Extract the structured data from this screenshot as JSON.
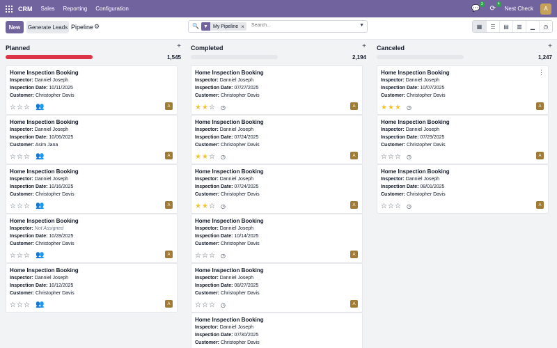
{
  "nav": {
    "app_name": "CRM",
    "menu": [
      "Sales",
      "Reporting",
      "Configuration"
    ],
    "chat_count": "3",
    "activity_count": "4",
    "company": "Nest Check",
    "user_initial": "A"
  },
  "control": {
    "new_label": "New",
    "generate_label": "Generate Leads",
    "breadcrumb": "Pipeline",
    "facet": "My Pipeline",
    "search_placeholder": "Search..."
  },
  "columns": [
    {
      "title": "Planned",
      "count": "1,545",
      "progress_fraction": 1.0,
      "cards": [
        {
          "title": "Home Inspection Booking",
          "inspector": "Danniel Joseph",
          "inspector_italic": false,
          "date": "10/11/2025",
          "customer": "Christopher Davis",
          "stars": 0,
          "icon": "people",
          "owner": "A"
        },
        {
          "title": "Home Inspection Booking",
          "inspector": "Danniel Joseph",
          "inspector_italic": false,
          "date": "10/06/2025",
          "customer": "Asim Jana",
          "stars": 0,
          "icon": "people",
          "owner": "A"
        },
        {
          "title": "Home Inspection Booking",
          "inspector": "Danniel Joseph",
          "inspector_italic": false,
          "date": "10/16/2025",
          "customer": "Christopher Davis",
          "stars": 0,
          "icon": "people",
          "owner": "A"
        },
        {
          "title": "Home Inspection Booking",
          "inspector": "Not Assigned",
          "inspector_italic": true,
          "date": "10/28/2025",
          "customer": "Christopher Davis",
          "stars": 0,
          "icon": "people",
          "owner": "A"
        },
        {
          "title": "Home Inspection Booking",
          "inspector": "Danniel Joseph",
          "inspector_italic": false,
          "date": "10/12/2025",
          "customer": "Christopher Davis",
          "stars": 0,
          "icon": "people",
          "owner": "A"
        }
      ]
    },
    {
      "title": "Completed",
      "count": "2,194",
      "progress_fraction": 0.0,
      "cards": [
        {
          "title": "Home Inspection Booking",
          "inspector": "Danniel Joseph",
          "inspector_italic": false,
          "date": "07/27/2025",
          "customer": "Christopher Davis",
          "stars": 2,
          "icon": "clock",
          "owner": "A"
        },
        {
          "title": "Home Inspection Booking",
          "inspector": "Danniel Joseph",
          "inspector_italic": false,
          "date": "07/24/2025",
          "customer": "Christopher Davis",
          "stars": 2,
          "icon": "clock",
          "owner": "A"
        },
        {
          "title": "Home Inspection Booking",
          "inspector": "Danniel Joseph",
          "inspector_italic": false,
          "date": "07/24/2025",
          "customer": "Christopher Davis",
          "stars": 2,
          "icon": "clock",
          "owner": "A"
        },
        {
          "title": "Home Inspection Booking",
          "inspector": "Danniel Joseph",
          "inspector_italic": false,
          "date": "10/14/2025",
          "customer": "Christopher Davis",
          "stars": 0,
          "icon": "clock",
          "owner": "A"
        },
        {
          "title": "Home Inspection Booking",
          "inspector": "Danniel Joseph",
          "inspector_italic": false,
          "date": "08/27/2025",
          "customer": "Christopher Davis",
          "stars": 0,
          "icon": "clock",
          "owner": "A"
        },
        {
          "title": "Home Inspection Booking",
          "inspector": "Danniel Joseph",
          "inspector_italic": false,
          "date": "07/30/2025",
          "customer": "Christopher Davis",
          "stars": 0,
          "icon": "clock",
          "owner": "A"
        }
      ]
    },
    {
      "title": "Canceled",
      "count": "1,247",
      "progress_fraction": 0.0,
      "cards": [
        {
          "title": "Home Inspection Booking",
          "inspector": "Danniel Joseph",
          "inspector_italic": false,
          "date": "10/07/2025",
          "customer": "Christopher Davis",
          "stars": 3,
          "icon": "clock",
          "owner": "A",
          "menu": true
        },
        {
          "title": "Home Inspection Booking",
          "inspector": "Danniel Joseph",
          "inspector_italic": false,
          "date": "07/29/2025",
          "customer": "Christopher Davis",
          "stars": 0,
          "icon": "clock",
          "owner": "A"
        },
        {
          "title": "Home Inspection Booking",
          "inspector": "Danniel Joseph",
          "inspector_italic": false,
          "date": "08/01/2025",
          "customer": "Christopher Davis",
          "stars": 0,
          "icon": "clock",
          "owner": "A"
        }
      ]
    }
  ],
  "labels": {
    "inspector": "Inspector:",
    "date": "Inspection Date:",
    "customer": "Customer:"
  },
  "colors": {
    "brand": "#71639e",
    "danger": "#dc3545",
    "star": "#f1c232",
    "owner_badge": "#a07b35"
  }
}
